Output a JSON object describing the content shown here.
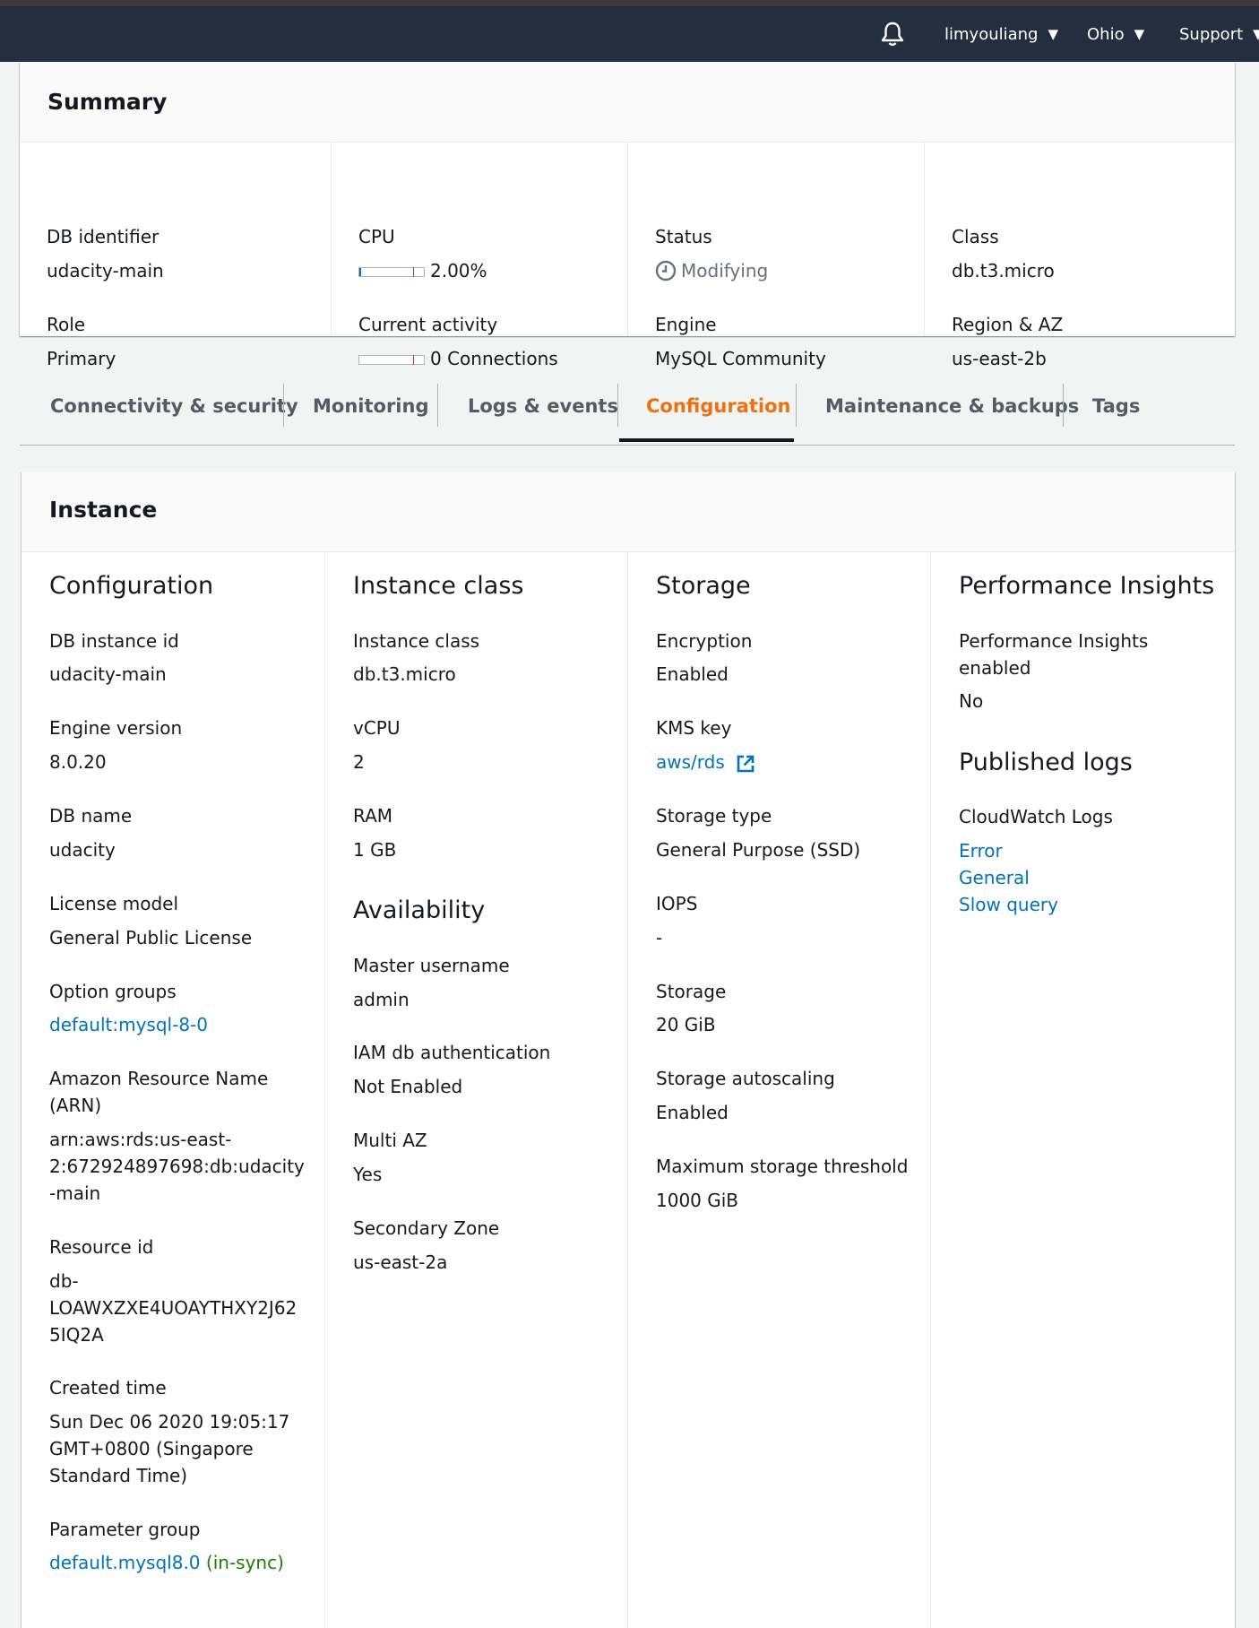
{
  "topbar": {
    "bell_icon": "bell-icon",
    "user": "limyouliang",
    "region": "Ohio",
    "support": "Support",
    "caret_icon": "caret-down-icon"
  },
  "summary": {
    "title": "Summary",
    "db_identifier_label": "DB identifier",
    "db_identifier": "udacity-main",
    "role_label": "Role",
    "role": "Primary",
    "cpu_label": "CPU",
    "cpu_value": "2.00%",
    "cpu_fraction": 0.02,
    "activity_label": "Current activity",
    "activity_value": "0 Connections",
    "status_label": "Status",
    "status": "Modifying",
    "engine_label": "Engine",
    "engine": "MySQL Community",
    "class_label": "Class",
    "class": "db.t3.micro",
    "region_label": "Region & AZ",
    "region": "us-east-2b"
  },
  "tabs": [
    {
      "label": "Connectivity & security"
    },
    {
      "label": "Monitoring"
    },
    {
      "label": "Logs & events"
    },
    {
      "label": "Configuration",
      "active": true
    },
    {
      "label": "Maintenance & backups"
    },
    {
      "label": "Tags"
    }
  ],
  "instance": {
    "title": "Instance",
    "configuration": {
      "heading": "Configuration",
      "db_instance_id_label": "DB instance id",
      "db_instance_id": "udacity-main",
      "engine_version_label": "Engine version",
      "engine_version": "8.0.20",
      "db_name_label": "DB name",
      "db_name": "udacity",
      "license_label": "License model",
      "license": "General Public License",
      "option_groups_label": "Option groups",
      "option_groups": "default:mysql-8-0",
      "arn_label_1": "Amazon Resource Name",
      "arn_label_2": "(ARN)",
      "arn_1": "arn:aws:rds:us-east-",
      "arn_2": "2:672924897698:db:udacity",
      "arn_3": "-main",
      "resource_id_label": "Resource id",
      "resource_id_1": "db-",
      "resource_id_2": "LOAWXZXE4UOAYTHXY2J62",
      "resource_id_3": "5IQ2A",
      "created_label": "Created time",
      "created_1": "Sun Dec 06 2020 19:05:17",
      "created_2": "GMT+0800 (Singapore",
      "created_3": "Standard Time)",
      "param_group_label": "Parameter group",
      "param_group": "default.mysql8.0",
      "param_group_status": "(in-sync)"
    },
    "instance_class": {
      "heading": "Instance class",
      "class_label": "Instance class",
      "class": "db.t3.micro",
      "vcpu_label": "vCPU",
      "vcpu": "2",
      "ram_label": "RAM",
      "ram": "1 GB"
    },
    "availability": {
      "heading": "Availability",
      "master_label": "Master username",
      "master": "admin",
      "iam_label": "IAM db authentication",
      "iam": "Not Enabled",
      "multi_az_label": "Multi AZ",
      "multi_az": "Yes",
      "secondary_label": "Secondary Zone",
      "secondary": "us-east-2a"
    },
    "storage": {
      "heading": "Storage",
      "encryption_label": "Encryption",
      "encryption": "Enabled",
      "kms_label": "KMS key",
      "kms": "aws/rds",
      "kms_icon": "external-link-icon",
      "type_label": "Storage type",
      "type": "General Purpose (SSD)",
      "iops_label": "IOPS",
      "iops": "-",
      "storage_label": "Storage",
      "storage": "20 GiB",
      "autoscaling_label": "Storage autoscaling",
      "autoscaling": "Enabled",
      "max_label": "Maximum storage threshold",
      "max": "1000 GiB"
    },
    "performance": {
      "heading": "Performance Insights",
      "pi_label_1": "Performance Insights",
      "pi_label_2": "enabled",
      "pi": "No"
    },
    "published_logs": {
      "heading": "Published logs",
      "cw_label": "CloudWatch Logs",
      "logs": [
        "Error",
        "General",
        "Slow query"
      ]
    }
  },
  "colors": {
    "topbar": "#232f3e",
    "link": "#0073bb",
    "active_tab": "#ec7211",
    "ok": "#1d8102",
    "muted": "#687078"
  }
}
